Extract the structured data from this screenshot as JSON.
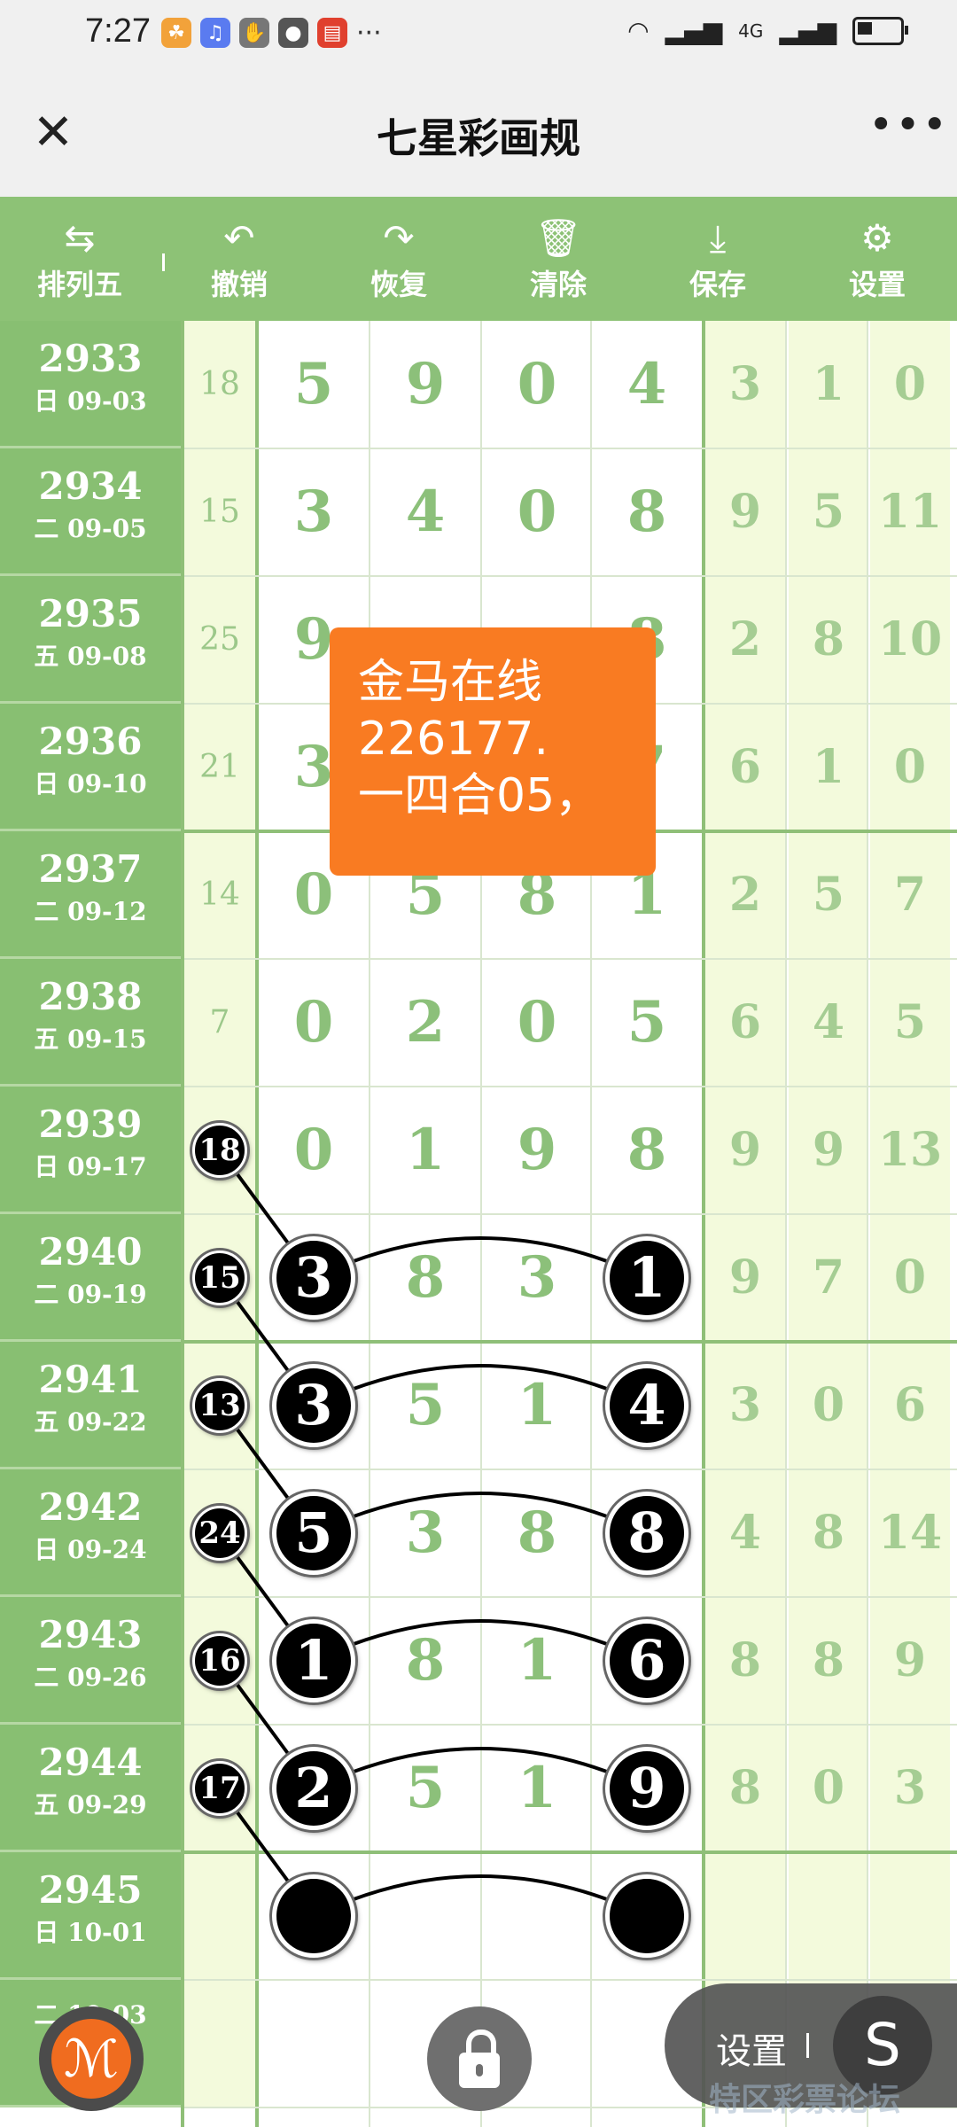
{
  "status": {
    "time": "7:27",
    "more": "···",
    "net": "4G",
    "icons": [
      "app-icon",
      "music-icon",
      "hand-icon",
      "chat-icon",
      "app-red-icon"
    ]
  },
  "header": {
    "title": "七星彩画规",
    "close": "✕",
    "more": "•••"
  },
  "toolbar": {
    "items": [
      {
        "label": "排列五",
        "icon": "⇆"
      },
      {
        "label": "撤销",
        "icon": "↶"
      },
      {
        "label": "恢复",
        "icon": "↷"
      },
      {
        "label": "清除",
        "icon": "🗑"
      },
      {
        "label": "保存",
        "icon": "⤓"
      },
      {
        "label": "设置",
        "icon": "⚙"
      }
    ]
  },
  "rows": [
    {
      "issue": "2933",
      "date": "日 09-03",
      "sum": "18",
      "d": [
        "5",
        "9",
        "0",
        "4"
      ],
      "x": [
        "3",
        "1",
        "0"
      ]
    },
    {
      "issue": "2934",
      "date": "二 09-05",
      "sum": "15",
      "d": [
        "3",
        "4",
        "0",
        "8"
      ],
      "x": [
        "9",
        "5",
        "11"
      ]
    },
    {
      "issue": "2935",
      "date": "五 09-08",
      "sum": "25",
      "d": [
        "9",
        "",
        "",
        "8"
      ],
      "x": [
        "2",
        "8",
        "10"
      ]
    },
    {
      "issue": "2936",
      "date": "日 09-10",
      "sum": "21",
      "d": [
        "3",
        "",
        "",
        "7"
      ],
      "x": [
        "6",
        "1",
        "0"
      ]
    },
    {
      "issue": "2937",
      "date": "二 09-12",
      "sum": "14",
      "d": [
        "0",
        "5",
        "8",
        "1"
      ],
      "x": [
        "2",
        "5",
        "7"
      ]
    },
    {
      "issue": "2938",
      "date": "五 09-15",
      "sum": "7",
      "d": [
        "0",
        "2",
        "0",
        "5"
      ],
      "x": [
        "6",
        "4",
        "5"
      ]
    },
    {
      "issue": "2939",
      "date": "日 09-17",
      "sum": "",
      "d": [
        "0",
        "1",
        "9",
        "8"
      ],
      "x": [
        "9",
        "9",
        "13"
      ]
    },
    {
      "issue": "2940",
      "date": "二 09-19",
      "sum": "",
      "d": [
        "",
        "8",
        "3",
        ""
      ],
      "x": [
        "9",
        "7",
        "0"
      ]
    },
    {
      "issue": "2941",
      "date": "五 09-22",
      "sum": "",
      "d": [
        "",
        "5",
        "1",
        ""
      ],
      "x": [
        "3",
        "0",
        "6"
      ]
    },
    {
      "issue": "2942",
      "date": "日 09-24",
      "sum": "",
      "d": [
        "",
        "3",
        "8",
        ""
      ],
      "x": [
        "4",
        "8",
        "14"
      ]
    },
    {
      "issue": "2943",
      "date": "二 09-26",
      "sum": "",
      "d": [
        "",
        "8",
        "1",
        ""
      ],
      "x": [
        "8",
        "8",
        "9"
      ]
    },
    {
      "issue": "2944",
      "date": "五 09-29",
      "sum": "",
      "d": [
        "",
        "5",
        "1",
        ""
      ],
      "x": [
        "8",
        "0",
        "3"
      ]
    },
    {
      "issue": "2945",
      "date": "日 10-01",
      "sum": "",
      "d": [
        "",
        "",
        "",
        ""
      ],
      "x": [
        "",
        "",
        ""
      ]
    },
    {
      "issue": "",
      "date": "二 10-03",
      "sum": "",
      "d": [
        "",
        "",
        "",
        ""
      ],
      "x": [
        "",
        "",
        ""
      ]
    }
  ],
  "marks": {
    "sums": [
      "18",
      "15",
      "13",
      "24",
      "16",
      "17"
    ],
    "first": [
      "3",
      "3",
      "5",
      "1",
      "2",
      ""
    ],
    "last": [
      "1",
      "4",
      "8",
      "6",
      "9",
      ""
    ]
  },
  "ad": {
    "line1": "金马在线",
    "line2": "226177.",
    "line3": "一四合05，"
  },
  "fab": {
    "settings_label": "设置",
    "s_label": "S",
    "brush": "ℳ"
  },
  "watermark": "特区彩票论坛"
}
